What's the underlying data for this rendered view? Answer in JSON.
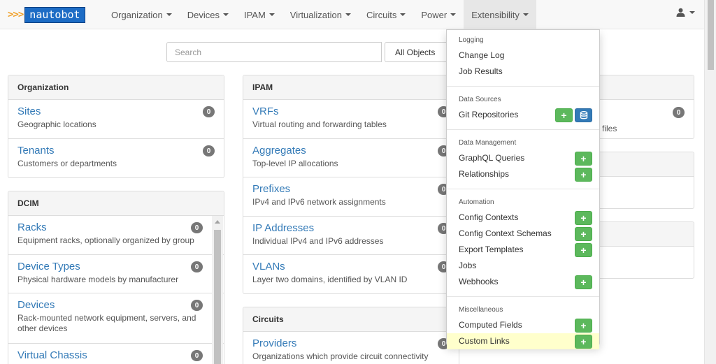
{
  "brand": {
    "arrows": ">>>",
    "name": "nautobot"
  },
  "nav": [
    {
      "label": "Organization"
    },
    {
      "label": "Devices"
    },
    {
      "label": "IPAM"
    },
    {
      "label": "Virtualization"
    },
    {
      "label": "Circuits"
    },
    {
      "label": "Power"
    },
    {
      "label": "Extensibility"
    }
  ],
  "search": {
    "placeholder": "Search",
    "scope": "All Objects"
  },
  "organization": {
    "title": "Organization",
    "items": [
      {
        "title": "Sites",
        "desc": "Geographic locations",
        "count": "0"
      },
      {
        "title": "Tenants",
        "desc": "Customers or departments",
        "count": "0"
      }
    ]
  },
  "dcim": {
    "title": "DCIM",
    "items": [
      {
        "title": "Racks",
        "desc": "Equipment racks, optionally organized by group",
        "count": "0"
      },
      {
        "title": "Device Types",
        "desc": "Physical hardware models by manufacturer",
        "count": "0"
      },
      {
        "title": "Devices",
        "desc": "Rack-mounted network equipment, servers, and other devices",
        "count": "0"
      },
      {
        "title": "Virtual Chassis",
        "desc": "",
        "count": "0"
      }
    ]
  },
  "ipam": {
    "title": "IPAM",
    "items": [
      {
        "title": "VRFs",
        "desc": "Virtual routing and forwarding tables",
        "count": "0"
      },
      {
        "title": "Aggregates",
        "desc": "Top-level IP allocations",
        "count": "0"
      },
      {
        "title": "Prefixes",
        "desc": "IPv4 and IPv6 network assignments",
        "count": "0"
      },
      {
        "title": "IP Addresses",
        "desc": "Individual IPv4 and IPv6 addresses",
        "count": "0"
      },
      {
        "title": "VLANs",
        "desc": "Layer two domains, identified by VLAN ID",
        "count": "0"
      }
    ]
  },
  "circuits": {
    "title": "Circuits",
    "items": [
      {
        "title": "Providers",
        "desc": "Organizations which provide circuit connectivity",
        "count": "0"
      }
    ]
  },
  "right_panel": {
    "count": "0",
    "desc_fragment": "files"
  },
  "dropdown": {
    "sections": [
      {
        "header": "Logging",
        "items": [
          {
            "label": "Change Log"
          },
          {
            "label": "Job Results"
          }
        ]
      },
      {
        "header": "Data Sources",
        "items": [
          {
            "label": "Git Repositories"
          }
        ]
      },
      {
        "header": "Data Management",
        "items": [
          {
            "label": "GraphQL Queries"
          },
          {
            "label": "Relationships"
          }
        ]
      },
      {
        "header": "Automation",
        "items": [
          {
            "label": "Config Contexts"
          },
          {
            "label": "Config Context Schemas"
          },
          {
            "label": "Export Templates"
          },
          {
            "label": "Jobs"
          },
          {
            "label": "Webhooks"
          }
        ]
      },
      {
        "header": "Miscellaneous",
        "items": [
          {
            "label": "Computed Fields"
          },
          {
            "label": "Custom Links"
          }
        ]
      }
    ]
  },
  "colors": {
    "link": "#337ab7",
    "badge": "#777777",
    "add": "#5cb85c",
    "import": "#337ab7",
    "highlight": "#ffffcc",
    "brand": "#1d6cc5",
    "arrows": "#f0a22e"
  },
  "icons": {
    "add": "plus-icon",
    "import": "database-import-icon",
    "user": "user-icon"
  }
}
